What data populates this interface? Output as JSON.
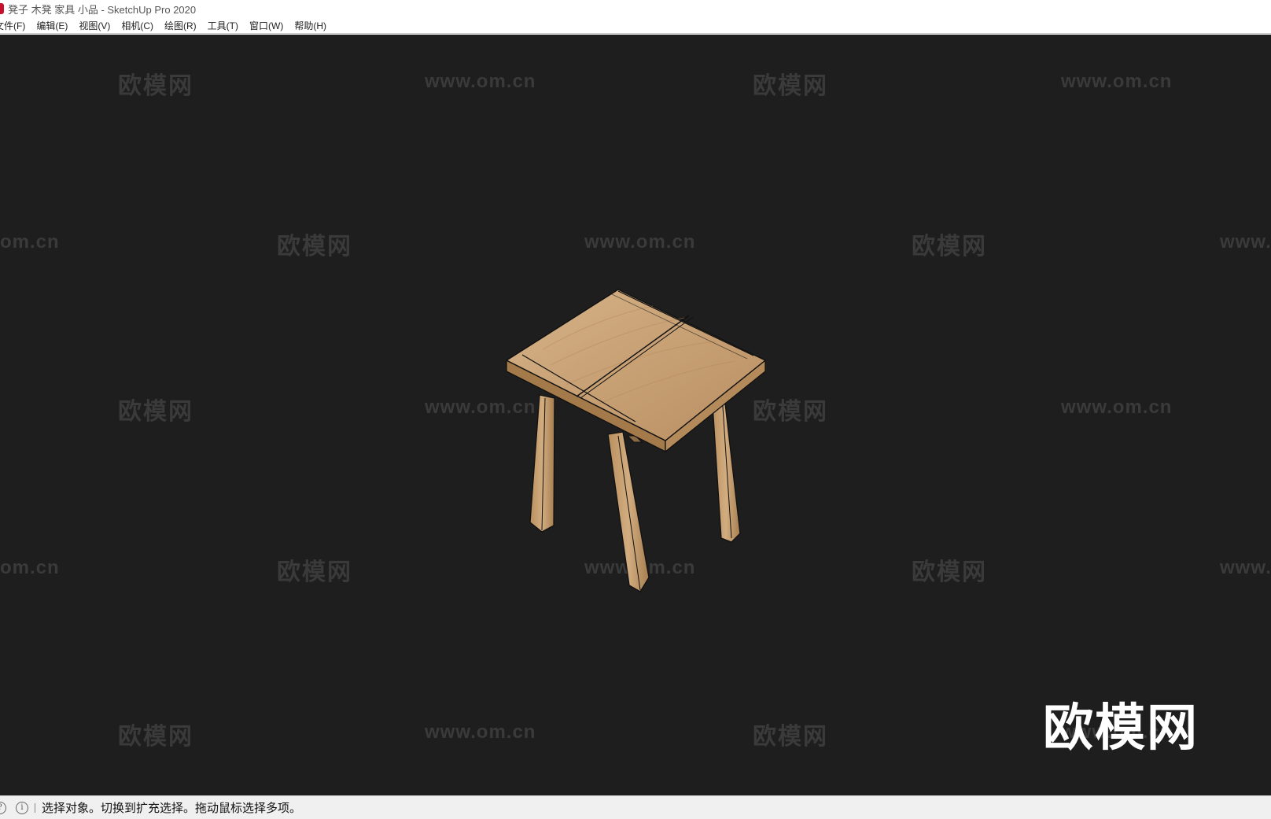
{
  "window": {
    "title": "凳子 木凳 家具 小品 - SketchUp Pro 2020"
  },
  "menubar": {
    "items": [
      {
        "label": "文件(F)"
      },
      {
        "label": "编辑(E)"
      },
      {
        "label": "视图(V)"
      },
      {
        "label": "相机(C)"
      },
      {
        "label": "绘图(R)"
      },
      {
        "label": "工具(T)"
      },
      {
        "label": "窗口(W)"
      },
      {
        "label": "帮助(H)"
      }
    ]
  },
  "watermark": {
    "brand": "欧模网",
    "url": "www.om.cn",
    "url_left_partial": "om.cn",
    "url_right_partial": "www."
  },
  "logo": {
    "text": "欧模网"
  },
  "statusbar": {
    "message": "选择对象。切换到扩充选择。拖动鼠标选择多项。"
  },
  "colors": {
    "viewport_bg": "#1e1e1e",
    "wood_top": "#c9a57a",
    "wood_side": "#a88050",
    "edge": "#111111"
  }
}
